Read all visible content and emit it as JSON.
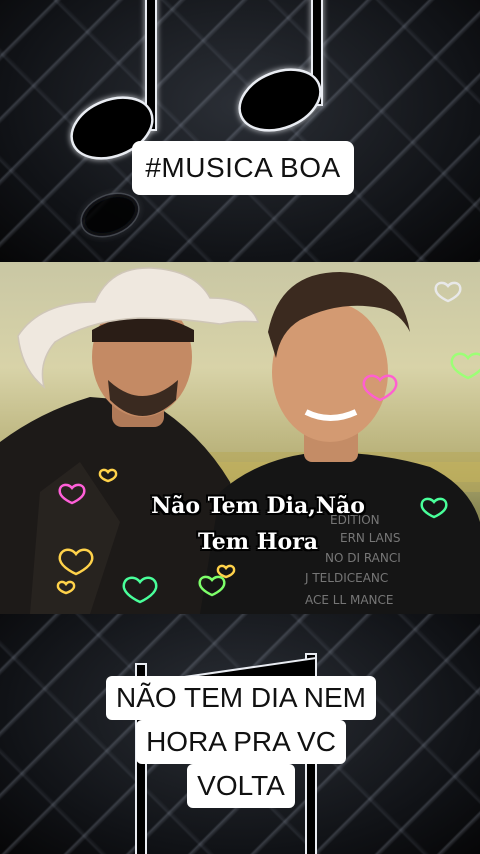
{
  "top_caption": "#MUSICA BOA",
  "overlay_title": {
    "line1": "Não Tem Dia,Não",
    "line2": "Tem Hora"
  },
  "bottom_caption": {
    "line1": "NÃO TEM DIA NEM",
    "line2": "HORA PRA VC",
    "line3": "VOLTA"
  },
  "colors": {
    "caption_bg": "#ffffff",
    "caption_text": "#111111",
    "heart_colors": [
      "#ff4fd8",
      "#ffd24a",
      "#49ff9a",
      "#7dff6a",
      "#ff7ad9"
    ]
  }
}
